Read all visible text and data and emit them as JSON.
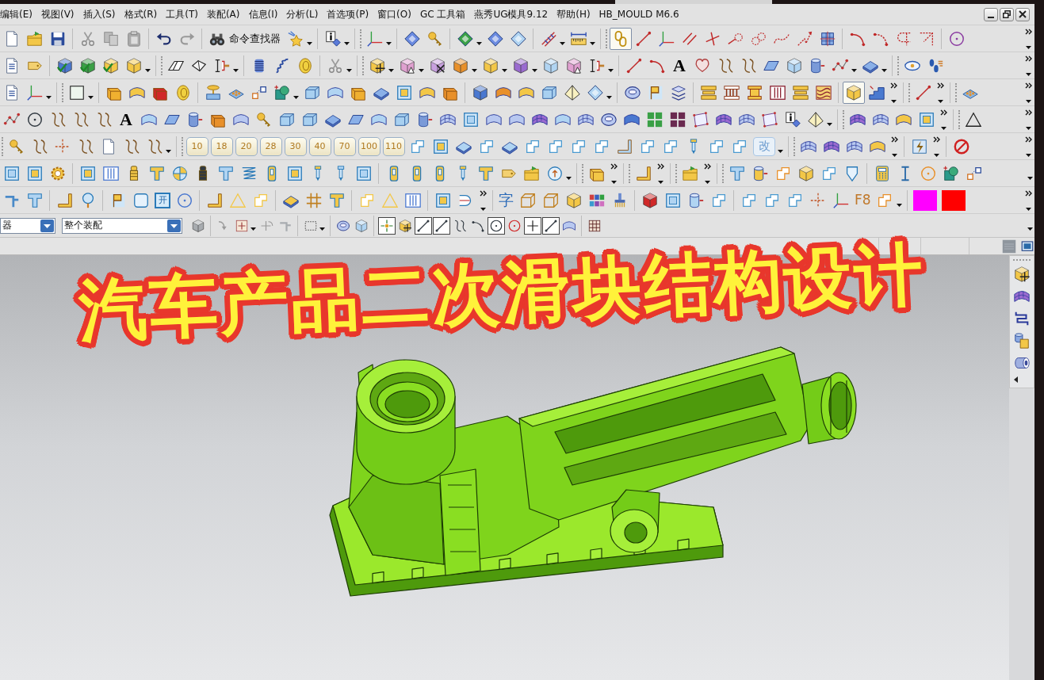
{
  "menu_bar": {
    "items": [
      "编辑(E)",
      "视图(V)",
      "插入(S)",
      "格式(R)",
      "工具(T)",
      "装配(A)",
      "信息(I)",
      "分析(L)",
      "首选项(P)",
      "窗口(O)",
      "GC 工具箱",
      "燕秀UG模具9.12",
      "帮助(H)",
      "HB_MOULD M6.6"
    ]
  },
  "toolbar": {
    "command_finder": "命令查找器",
    "text_icons": [
      "A",
      "A",
      "改",
      "开",
      "字",
      "F8"
    ],
    "size_buttons": [
      "10",
      "18",
      "20",
      "28",
      "30",
      "40",
      "70",
      "100",
      "110"
    ],
    "toggles": [
      {
        "on": true
      },
      {
        "on": true
      }
    ],
    "swatches": [
      {
        "color": "#ff00ff"
      },
      {
        "color": "#ff0000"
      }
    ]
  },
  "selection_bar": {
    "filter": "器",
    "scope": "整个装配",
    "snap_buttons": [
      {
        "on": true
      },
      {
        "on": false
      },
      {
        "on": true
      },
      {
        "on": true
      },
      {
        "on": false
      },
      {
        "on": false
      },
      {
        "on": true
      },
      {
        "on": false
      },
      {
        "on": true
      },
      {
        "on": true
      },
      {
        "on": false
      }
    ]
  },
  "video_title": "汽车产品二次滑块结构设计"
}
